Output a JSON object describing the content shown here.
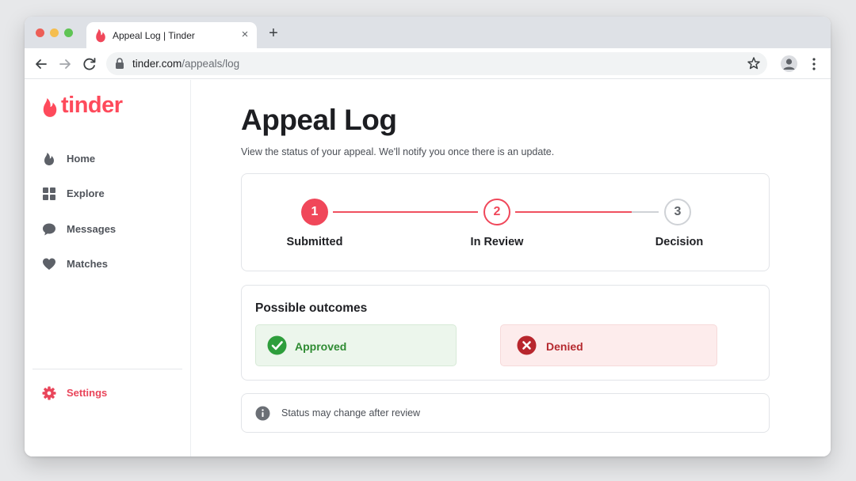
{
  "browser": {
    "tab_title": "Appeal Log | Tinder",
    "tab_close_glyph": "×",
    "new_tab_glyph": "+",
    "url_host": "tinder.com",
    "url_path": "/appeals/log",
    "icons": [
      "back-arrow-icon",
      "forward-arrow-icon",
      "reload-icon",
      "lock-icon",
      "star-icon",
      "profile-icon",
      "kebab-menu-icon"
    ]
  },
  "brand": {
    "name": "tinder",
    "color": "#fe4a5b"
  },
  "sidebar": {
    "items": [
      {
        "label": "Home",
        "icon": "flame-icon"
      },
      {
        "label": "Explore",
        "icon": "grid-icon"
      },
      {
        "label": "Messages",
        "icon": "chat-bubble-icon"
      },
      {
        "label": "Matches",
        "icon": "heart-icon"
      }
    ],
    "settings": {
      "label": "Settings",
      "icon": "gear-icon",
      "color": "#e9455a"
    }
  },
  "page": {
    "title": "Appeal Log",
    "subtitle": "View the status of your appeal. We'll notify you once there is an update."
  },
  "progress": {
    "steps": [
      {
        "number": "1",
        "label": "Submitted",
        "state": "complete"
      },
      {
        "number": "2",
        "label": "In Review",
        "state": "current"
      },
      {
        "number": "3",
        "label": "Decision",
        "state": "pending"
      }
    ],
    "active_color": "#f0475a",
    "inactive_color": "#cfd2d6"
  },
  "outcomes": {
    "title": "Possible outcomes",
    "approved": {
      "label": "Approved",
      "icon": "check-circle-icon",
      "color": "#2e8b32"
    },
    "denied": {
      "label": "Denied",
      "icon": "x-circle-icon",
      "color": "#b52a2f"
    }
  },
  "note": {
    "text": "Status may change after review",
    "icon": "info-icon"
  }
}
